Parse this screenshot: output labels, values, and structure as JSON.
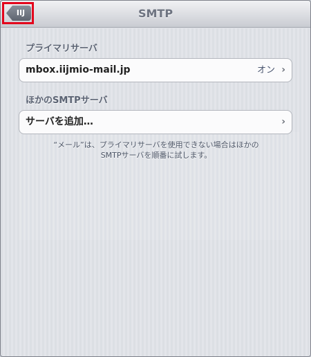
{
  "navbar": {
    "back_label": "IIJ",
    "title": "SMTP"
  },
  "primary_section": {
    "header": "プライマリサーバ",
    "server_name": "mbox.iijmio-mail.jp",
    "status": "オン"
  },
  "other_section": {
    "header": "ほかのSMTPサーバ",
    "add_label": "サーバを追加…"
  },
  "footnote": {
    "line1": "“メール”は、プライマリサーバを使用できない場合はほかの",
    "line2": "SMTPサーバを順番に試します。"
  },
  "icons": {
    "chevron": "chevron-right-icon"
  },
  "colors": {
    "highlight": "#e3001b",
    "title": "#6d7380"
  }
}
